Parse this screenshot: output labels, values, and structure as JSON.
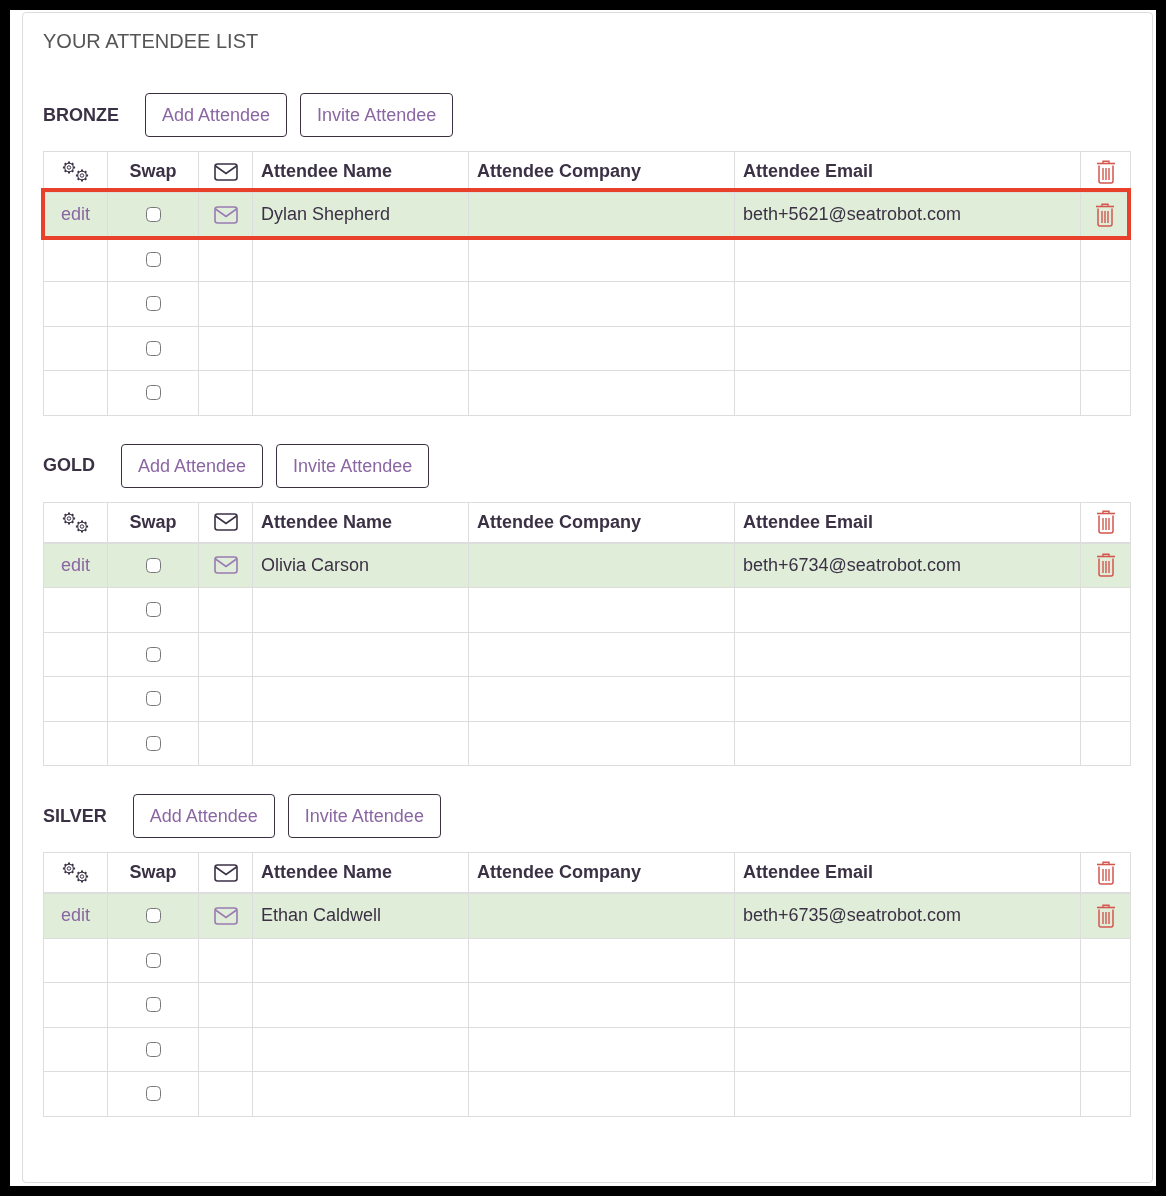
{
  "title": "YOUR ATTENDEE LIST",
  "sections": [
    {
      "name": "BRONZE",
      "buttons": [
        "Add Attendee",
        "Invite Attendee"
      ],
      "columns": [
        "Swap",
        "Attendee Name",
        "Attendee Company",
        "Attendee Email"
      ],
      "rows": [
        {
          "kind": "attendee",
          "action": "edit",
          "checked": false,
          "name": "Dylan Shepherd",
          "email": "beth+5621@seatrobot.com",
          "highlighted": true
        },
        {
          "kind": "empty",
          "checked": false,
          "highlighted": false
        },
        {
          "kind": "empty",
          "checked": false,
          "highlighted": false
        },
        {
          "kind": "empty",
          "checked": false,
          "highlighted": false
        },
        {
          "kind": "empty",
          "checked": false,
          "highlighted": false
        }
      ]
    },
    {
      "name": "GOLD",
      "buttons": [
        "Add Attendee",
        "Invite Attendee"
      ],
      "columns": [
        "Swap",
        "Attendee Name",
        "Attendee Company",
        "Attendee Email"
      ],
      "rows": [
        {
          "kind": "attendee",
          "action": "edit",
          "checked": false,
          "name": "Olivia Carson",
          "email": "beth+6734@seatrobot.com",
          "highlighted": false
        },
        {
          "kind": "empty",
          "checked": false,
          "highlighted": false
        },
        {
          "kind": "empty",
          "checked": false,
          "highlighted": false
        },
        {
          "kind": "empty",
          "checked": false,
          "highlighted": false
        },
        {
          "kind": "empty",
          "checked": false,
          "highlighted": false
        }
      ]
    },
    {
      "name": "SILVER",
      "buttons": [
        "Add Attendee",
        "Invite Attendee"
      ],
      "columns": [
        "Swap",
        "Attendee Name",
        "Attendee Company",
        "Attendee Email"
      ],
      "rows": [
        {
          "kind": "attendee",
          "action": "edit",
          "checked": false,
          "name": "Ethan Caldwell",
          "email": "beth+6735@seatrobot.com",
          "highlighted": false
        },
        {
          "kind": "empty",
          "checked": false,
          "highlighted": false
        },
        {
          "kind": "empty",
          "checked": false,
          "highlighted": false
        },
        {
          "kind": "empty",
          "checked": false,
          "highlighted": false
        },
        {
          "kind": "empty",
          "checked": false,
          "highlighted": false
        }
      ]
    }
  ]
}
